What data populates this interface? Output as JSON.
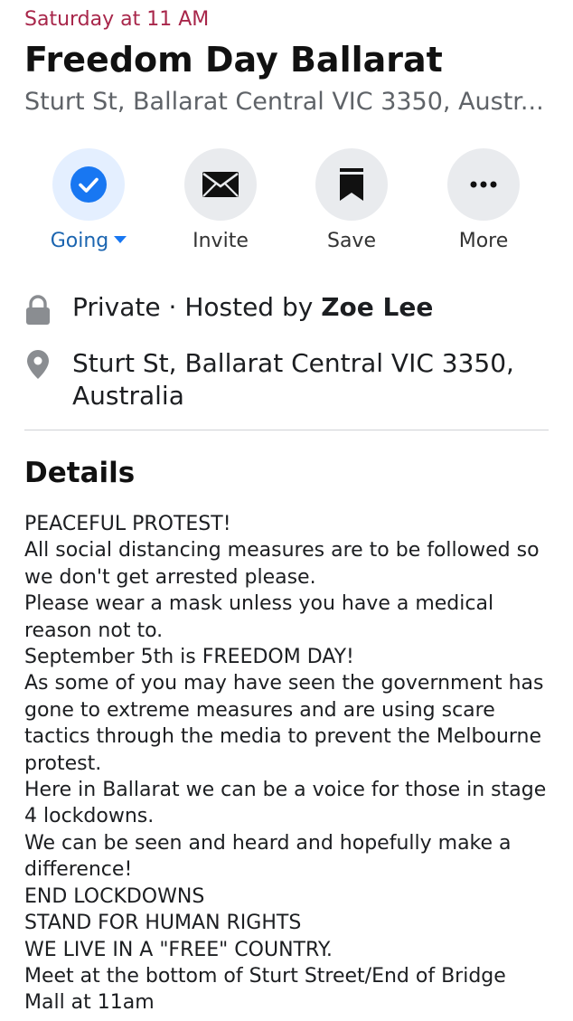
{
  "event": {
    "date": "Saturday at 11 AM",
    "title": "Freedom Day Ballarat",
    "subtitle": "Sturt St, Ballarat Central VIC 3350, Austr..."
  },
  "actions": {
    "going": {
      "label": "Going",
      "icon": "check-circle-icon"
    },
    "invite": {
      "label": "Invite",
      "icon": "envelope-icon"
    },
    "save": {
      "label": "Save",
      "icon": "bookmark-icon"
    },
    "more": {
      "label": "More",
      "icon": "ellipsis-icon"
    }
  },
  "info": {
    "privacy": {
      "prefix": "Private · Hosted by ",
      "host": "Zoe Lee",
      "icon": "lock-icon"
    },
    "location": {
      "line1": "Sturt St, Ballarat Central VIC 3350,",
      "line2": "Australia",
      "icon": "map-pin-icon"
    }
  },
  "details": {
    "heading": "Details",
    "lines": [
      "PEACEFUL PROTEST!",
      "All social distancing measures are to be followed so",
      "we don't get arrested please.",
      "Please wear a mask unless you have a medical",
      "reason not to.",
      "September 5th is FREEDOM DAY!",
      "As some of you may have seen the government has",
      "gone to extreme measures and are using scare",
      "tactics through the media to prevent the Melbourne",
      "protest.",
      "Here in Ballarat we can be a voice for those in stage",
      "4 lockdowns.",
      "We can be seen and heard and hopefully make a",
      "difference!",
      "END LOCKDOWNS",
      "STAND FOR HUMAN RIGHTS",
      "WE LIVE IN A \"FREE\" COUNTRY.",
      "Meet at the bottom of Sturt Street/End of Bridge",
      "Mall at 11am"
    ]
  },
  "colors": {
    "date": "#a8264a",
    "accent": "#1877f2",
    "going_label": "#1b65b0",
    "icon_gray": "#8a8d91"
  }
}
